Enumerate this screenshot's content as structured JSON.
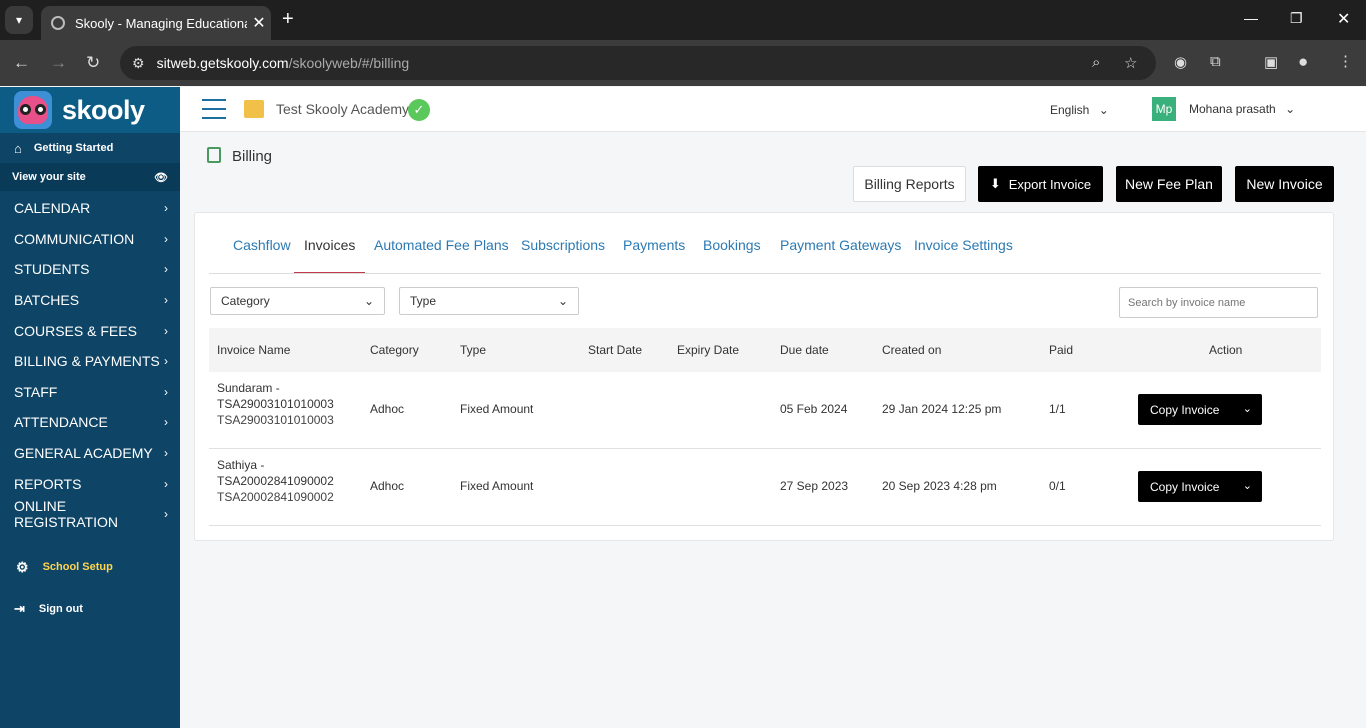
{
  "browser": {
    "tab_title": "Skooly - Managing Educational",
    "url_host": "sitweb.getskooly.com",
    "url_path": "/skoolyweb/#/billing"
  },
  "sidebar": {
    "logo_text": "skooly",
    "getting_started": "Getting Started",
    "view_site": "View your site",
    "items": [
      {
        "label": "CALENDAR"
      },
      {
        "label": "COMMUNICATION"
      },
      {
        "label": "STUDENTS"
      },
      {
        "label": "BATCHES"
      },
      {
        "label": "COURSES & FEES"
      },
      {
        "label": "BILLING & PAYMENTS"
      },
      {
        "label": "STAFF"
      },
      {
        "label": "ATTENDANCE"
      },
      {
        "label": "GENERAL ACADEMY"
      },
      {
        "label": "REPORTS"
      },
      {
        "label": "ONLINE REGISTRATION"
      }
    ],
    "school_setup": "School Setup",
    "sign_out": "Sign out"
  },
  "header": {
    "school": "Test Skooly Academy",
    "language": "English",
    "avatar_initials": "Mp",
    "user": "Mohana prasath"
  },
  "page": {
    "title": "Billing",
    "buttons": {
      "billing_reports": "Billing Reports",
      "export_invoice": "Export Invoice",
      "new_fee_plan": "New Fee Plan",
      "new_invoice": "New Invoice"
    },
    "tabs": [
      "Cashflow",
      "Invoices",
      "Automated Fee Plans",
      "Subscriptions",
      "Payments",
      "Bookings",
      "Payment Gateways",
      "Invoice Settings"
    ],
    "active_tab": "Invoices",
    "filters": {
      "category": "Category",
      "type": "Type",
      "search_placeholder": "Search by invoice name"
    },
    "columns": [
      "Invoice Name",
      "Category",
      "Type",
      "Start Date",
      "Expiry Date",
      "Due date",
      "Created on",
      "Paid",
      "Action"
    ],
    "rows": [
      {
        "name1": "Sundaram -",
        "name2": "TSA29003101010003",
        "code": "TSA29003101010003",
        "category": "Adhoc",
        "type": "Fixed Amount",
        "start": "",
        "expiry": "",
        "due": "05 Feb 2024",
        "created": "29 Jan 2024 12:25 pm",
        "paid": "1/1",
        "action": "Copy Invoice"
      },
      {
        "name1": "Sathiya -",
        "name2": "TSA20002841090002",
        "code": "TSA20002841090002",
        "category": "Adhoc",
        "type": "Fixed Amount",
        "start": "",
        "expiry": "",
        "due": "27 Sep 2023",
        "created": "20 Sep 2023 4:28 pm",
        "paid": "0/1",
        "action": "Copy Invoice"
      }
    ]
  }
}
